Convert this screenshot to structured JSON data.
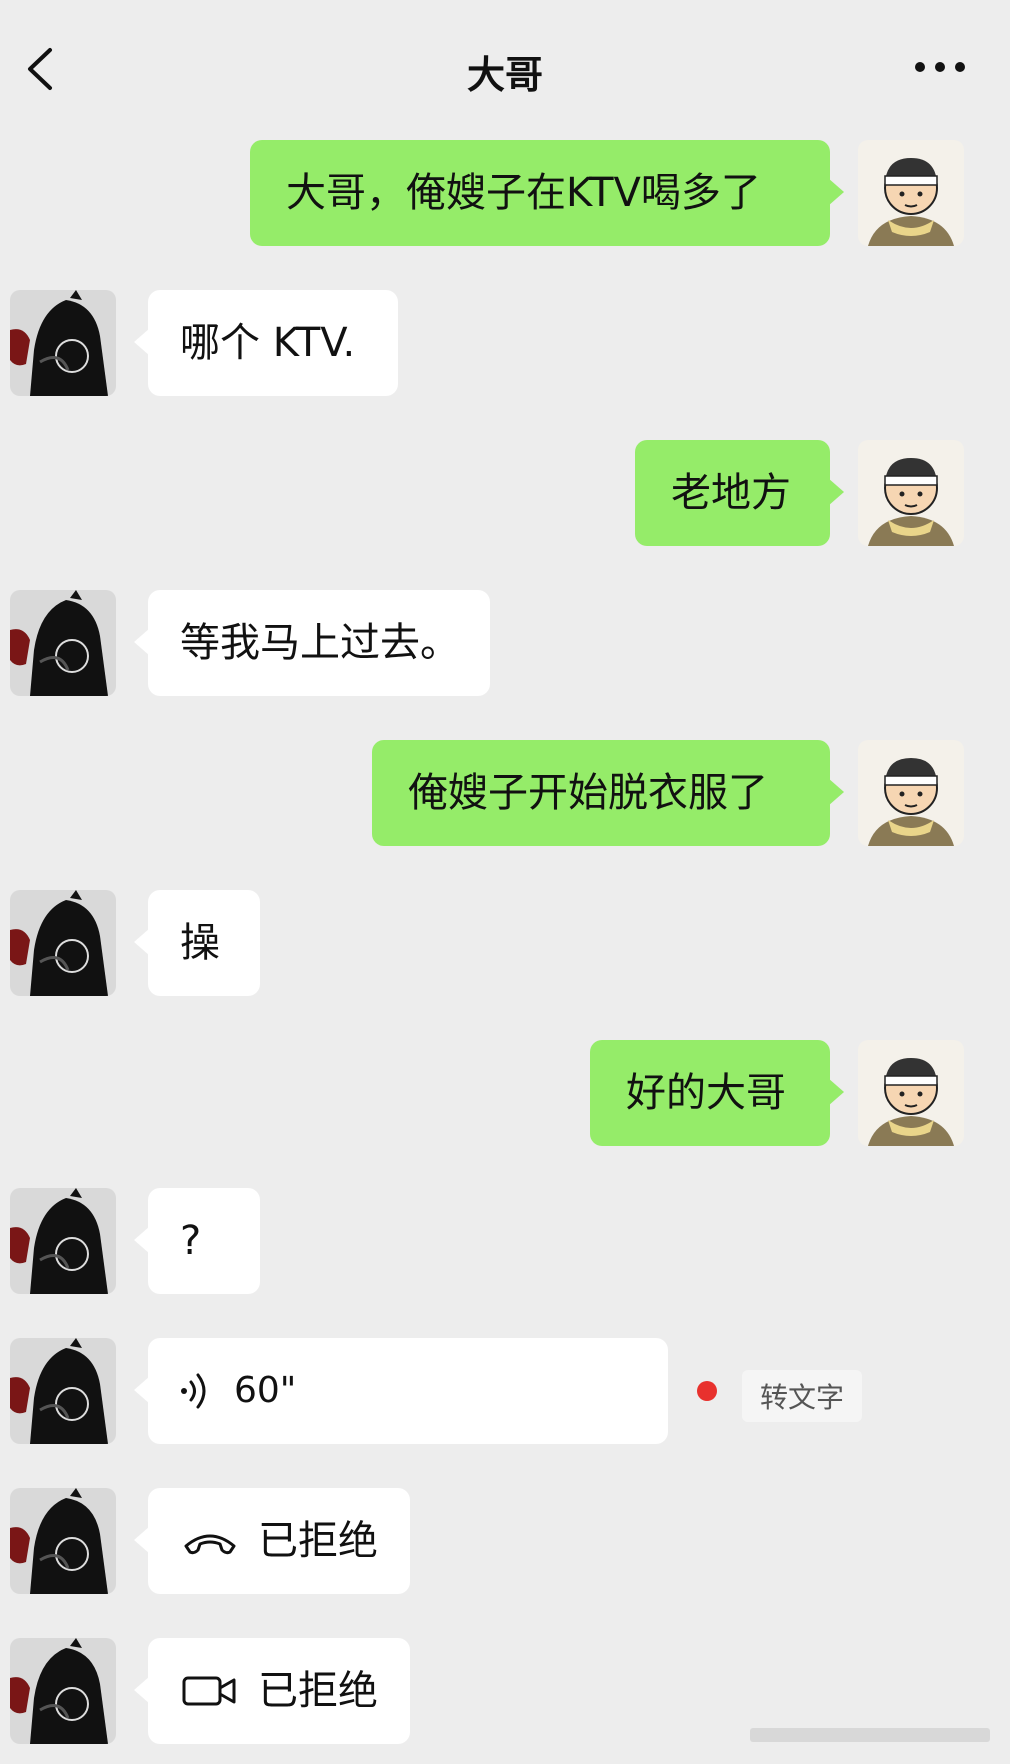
{
  "header": {
    "title": "大哥"
  },
  "messages": [
    {
      "from": "me",
      "text": "大哥，俺嫂子在KTV喝多了"
    },
    {
      "from": "them",
      "text": "哪个 KTV."
    },
    {
      "from": "me",
      "text": "老地方"
    },
    {
      "from": "them",
      "text": "等我马上过去。"
    },
    {
      "from": "me",
      "text": "俺嫂子开始脱衣服了"
    },
    {
      "from": "them",
      "text": "操"
    },
    {
      "from": "me",
      "text": "好的大哥"
    },
    {
      "from": "them",
      "text": "?"
    }
  ],
  "voice": {
    "duration": "60\"",
    "transcribe_label": "转文字"
  },
  "calls": [
    {
      "type": "voice",
      "status": "已拒绝"
    },
    {
      "type": "video",
      "status": "已拒绝"
    }
  ],
  "colors": {
    "background": "#ededed",
    "my_bubble": "#95ec69",
    "their_bubble": "#ffffff",
    "unread_dot": "#e8312d"
  },
  "icons": {
    "back": "chevron-left-icon",
    "more": "more-dots-icon",
    "voice": "voice-wave-icon",
    "voice_call": "phone-handset-icon",
    "video_call": "video-camera-icon"
  }
}
